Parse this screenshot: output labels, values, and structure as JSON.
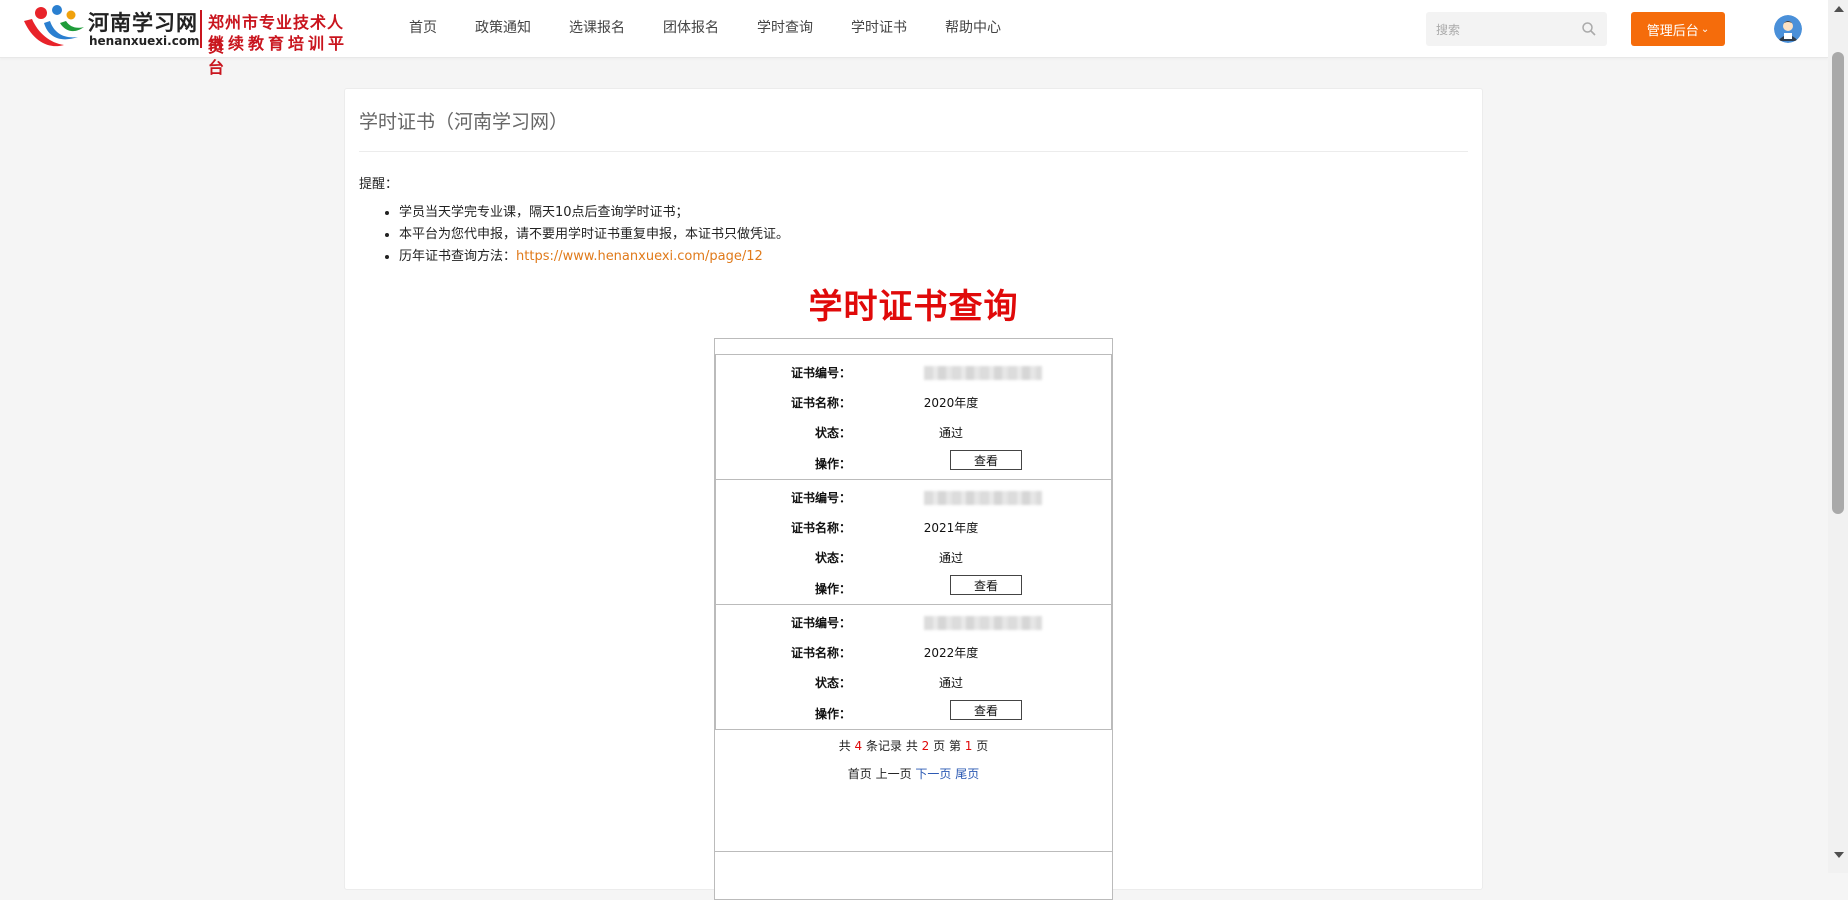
{
  "header": {
    "logo": {
      "cn": "河南学习网",
      "en": "henanxuexi.com",
      "sub_line1": "郑州市专业技术人员",
      "sub_line2": "继续教育培训平台"
    },
    "nav": [
      "首页",
      "政策通知",
      "选课报名",
      "团体报名",
      "学时查询",
      "学时证书",
      "帮助中心"
    ],
    "search_placeholder": "搜索",
    "admin_button": "管理后台",
    "accent_color": "#f56c0b"
  },
  "page": {
    "title": "学时证书（河南学习网）",
    "remind_label": "提醒：",
    "reminders": [
      {
        "text": "学员当天学完专业课，隔天10点后查询学时证书；"
      },
      {
        "text": "本平台为您代申报，请不要用学时证书重复申报，本证书只做凭证。"
      },
      {
        "text": "历年证书查询方法：",
        "link": "https://www.henanxuexi.com/page/12"
      }
    ],
    "main_title": "学时证书查询",
    "labels": {
      "cert_no": "证书编号：",
      "cert_name": "证书名称：",
      "status": "状态：",
      "action": "操作："
    },
    "records": [
      {
        "name": "2020年度",
        "status": "通过",
        "action": "查看"
      },
      {
        "name": "2021年度",
        "status": "通过",
        "action": "查看"
      },
      {
        "name": "2022年度",
        "status": "通过",
        "action": "查看"
      }
    ],
    "pager": {
      "t1": "共",
      "total_records": "4",
      "t2": "条记录 共",
      "total_pages": "2",
      "t3": "页 第",
      "current_page": "1",
      "t4": "页",
      "first": "首页",
      "prev": "上一页",
      "next": "下一页",
      "last": "尾页"
    }
  }
}
